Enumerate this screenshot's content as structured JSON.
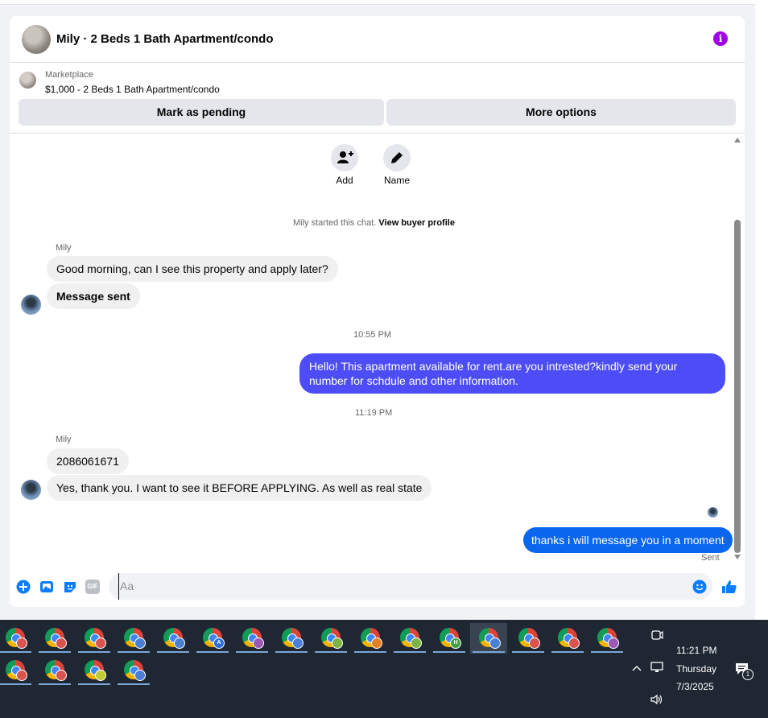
{
  "header": {
    "title": "Mily · 2 Beds 1 Bath Apartment/condo"
  },
  "marketplace": {
    "label": "Marketplace",
    "listing": "$1,000 - 2 Beds 1 Bath Apartment/condo"
  },
  "actions": {
    "pending": "Mark as pending",
    "more": "More options"
  },
  "chat_actions": {
    "add": "Add",
    "name": "Name"
  },
  "chat": {
    "started_text": "Mily started this chat.",
    "view_profile": "View buyer profile",
    "sender1": "Mily",
    "msg1": "Good morning, can I see this property and apply later?",
    "msg2": "Message sent",
    "time1": "10:55 PM",
    "out1": "Hello! This apartment available for rent.are you intrested?kindly send your number for schdule and other information.",
    "time2": "11:19 PM",
    "sender2": "Mily",
    "msg3": "2086061671",
    "msg4": "Yes, thank you. I want to see it BEFORE APPLYING. As well as real state",
    "out2": "thanks i will message you in a moment",
    "sent_status": "Sent"
  },
  "composer": {
    "placeholder": "Aa",
    "gif_label": "GIF"
  },
  "taskbar": {
    "time": "11:21 PM",
    "day": "Thursday",
    "date": "7/3/2025",
    "notification_count": "1",
    "apps_row1": [
      {
        "badge": "",
        "badge_color": "#d9534f"
      },
      {
        "badge": "",
        "badge_color": "#d9534f"
      },
      {
        "badge": "",
        "badge_color": "#d9534f"
      },
      {
        "badge": "",
        "badge_color": "#4a7fd4"
      },
      {
        "badge": "",
        "badge_color": "#4a7fd4"
      },
      {
        "badge": "A",
        "badge_color": "#2d6cdf"
      },
      {
        "badge": "",
        "badge_color": "#9b59b6"
      },
      {
        "badge": "",
        "badge_color": "#4a7fd4"
      },
      {
        "badge": "",
        "badge_color": "#7cb342"
      },
      {
        "badge": "",
        "badge_color": "#e67e22"
      },
      {
        "badge": "",
        "badge_color": "#7cb342"
      },
      {
        "badge": "H",
        "badge_color": "#43a047"
      },
      {
        "badge": "",
        "badge_color": "#4a7fd4"
      },
      {
        "badge": "",
        "badge_color": "#d9534f"
      },
      {
        "badge": "",
        "badge_color": "#d9534f"
      },
      {
        "badge": "",
        "badge_color": "#9b59b6"
      }
    ],
    "apps_row2": [
      {
        "badge": "",
        "badge_color": "#d9534f"
      },
      {
        "badge": "",
        "badge_color": "#d9534f"
      },
      {
        "badge": "",
        "badge_color": "#c0ca33"
      },
      {
        "badge": "",
        "badge_color": "#4a7fd4"
      }
    ]
  }
}
